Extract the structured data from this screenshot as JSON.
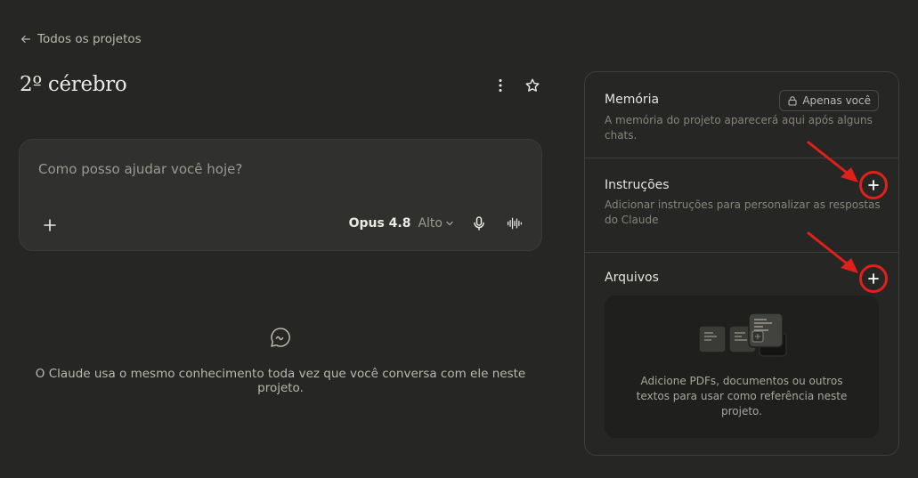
{
  "nav": {
    "back_label": "Todos os projetos"
  },
  "project": {
    "title": "2º cérebro"
  },
  "composer": {
    "placeholder": "Como posso ajudar você hoje?",
    "model_name": "Opus 4.8",
    "model_level": "Alto"
  },
  "empty_state": {
    "text": "O Claude usa o mesmo conhecimento toda vez que você conversa com ele neste projeto."
  },
  "panel": {
    "memory": {
      "title": "Memória",
      "badge": "Apenas você",
      "description": "A memória do projeto aparecerá aqui após alguns chats."
    },
    "instructions": {
      "title": "Instruções",
      "description": "Adicionar instruções para personalizar as respostas do Claude"
    },
    "files": {
      "title": "Arquivos",
      "description": "Adicione PDFs, documentos ou outros textos para usar como referência neste projeto."
    }
  },
  "colors": {
    "background": "#262624",
    "composer_bg": "#30302e",
    "annotation_red": "#e0201b",
    "text_primary": "#ece9e2",
    "text_muted": "#87847b"
  },
  "icons": {
    "back": "arrow-left-icon",
    "more": "more-vertical-icon",
    "star": "star-icon",
    "plus": "plus-icon",
    "chevron": "chevron-down-icon",
    "mic": "microphone-icon",
    "voice": "voice-wave-icon",
    "chat": "chat-bubble-icon",
    "lock": "lock-icon"
  }
}
